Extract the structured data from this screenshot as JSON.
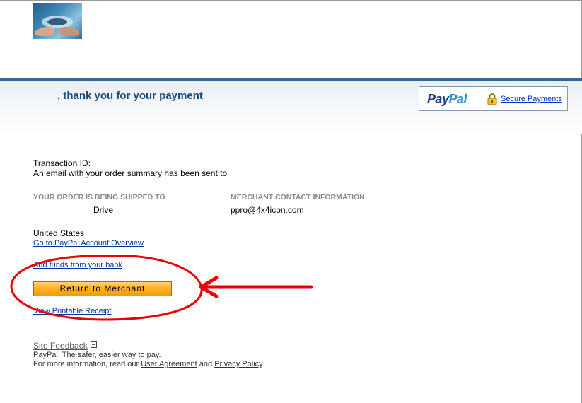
{
  "header": {
    "thank_you": ", thank you for your payment",
    "paypal_logo_part1": "Pay",
    "paypal_logo_part2": "Pal",
    "secure_payments": "Secure Payments"
  },
  "transaction": {
    "id_label": "Transaction ID:",
    "email_notice": "An email with your order summary has been sent to"
  },
  "shipping": {
    "heading": "YOUR ORDER IS BEING SHIPPED TO",
    "address_line": "Drive",
    "country": "United States"
  },
  "merchant": {
    "heading": "MERCHANT CONTACT INFORMATION",
    "email": "ppro@4x4icon.com"
  },
  "links": {
    "account_overview": "Go to PayPal Account Overview",
    "add_funds": "Add funds from your bank",
    "return_to_merchant": "Return to Merchant",
    "printable_receipt": "View Printable Receipt"
  },
  "footer": {
    "site_feedback": "Site Feedback",
    "collapse_symbol": "−",
    "tagline": "PayPal. The safer, easier way to pay.",
    "more_info_prefix": "For more information, read our ",
    "user_agreement": "User Agreement",
    "and_text": " and ",
    "privacy_policy": "Privacy Policy",
    "period": "."
  },
  "colors": {
    "header_line": "#336699",
    "heading_text": "#1d4a7c",
    "button_orange": "#ffb22a",
    "annotation_red": "#ee0000"
  },
  "icons": {
    "logo": "hands-globe-image",
    "lock": "lock-icon"
  }
}
